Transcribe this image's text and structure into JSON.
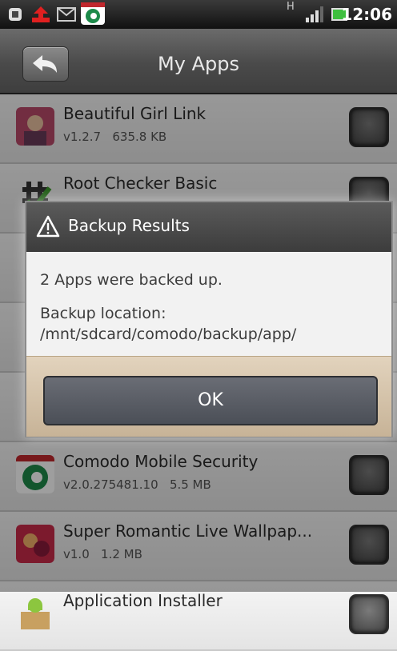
{
  "status_bar": {
    "time": "12:06",
    "network_label": "H"
  },
  "header": {
    "title": "My Apps"
  },
  "apps": [
    {
      "name": "Beautiful Girl Link",
      "version": "v1.2.7",
      "size": "635.8 KB"
    },
    {
      "name": "Root Checker Basic",
      "version": "",
      "size": ""
    },
    {
      "name": "Comodo Mobile Security",
      "version": "v2.0.275481.10",
      "size": "5.5 MB"
    },
    {
      "name": "Super Romantic Live Wallpap...",
      "version": "v1.0",
      "size": "1.2 MB"
    },
    {
      "name": "Application Installer",
      "version": "",
      "size": ""
    }
  ],
  "dialog": {
    "title": "Backup Results",
    "message": "2 Apps were backed up.",
    "location_label": "Backup location:",
    "location_path": "/mnt/sdcard/comodo/backup/app/",
    "ok_label": "OK"
  },
  "colors": {
    "title_bar": "#4a4a4a",
    "dialog_footer": "#c7b397",
    "ok_button": "#4b4f57"
  }
}
